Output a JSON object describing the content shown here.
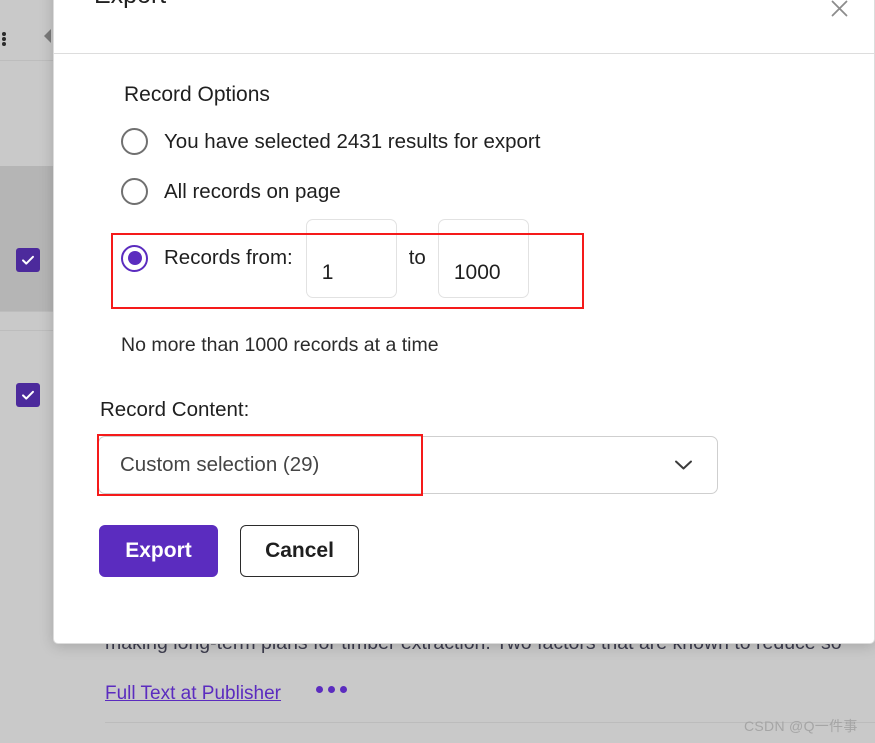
{
  "modal": {
    "title": "Export",
    "close_icon": "close-icon",
    "section_title": "Record Options",
    "options": [
      {
        "label": "You have selected 2431 results for export",
        "selected": false
      },
      {
        "label": "All records on page",
        "selected": false
      }
    ],
    "range_option": {
      "label": "Records from:",
      "from_value": "1",
      "from_placeholder": "1",
      "to_word": "to",
      "to_value": "1000",
      "to_placeholder": "1000",
      "selected": true
    },
    "hint": "No more than 1000 records at a time",
    "content_label": "Record Content:",
    "content_select": {
      "value": "Custom selection (29)",
      "chevron_icon": "chevron-down-icon"
    },
    "buttons": {
      "primary": "Export",
      "secondary": "Cancel"
    },
    "highlight_color": "#f51a1a",
    "accent_color": "#5b2cbf"
  },
  "background": {
    "record_text": "making long-term plans for timber extraction. Two factors that are known to reduce so",
    "link_text": "Full Text at Publisher",
    "more_actions_icon": "ellipsis-icon",
    "checkbox_icon": "checkmark-icon",
    "kebab_icon": "kebab-menu-icon",
    "collapse_icon": "collapse-arrow-icon",
    "watermark": "CSDN @Q一件事"
  }
}
